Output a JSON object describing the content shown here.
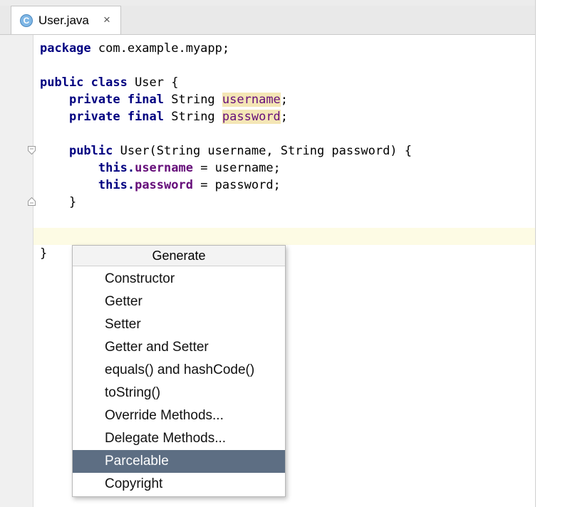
{
  "tab": {
    "icon_letter": "C",
    "label": "User.java",
    "close": "×"
  },
  "code": {
    "l1_kw": "package",
    "l1_rest": " com.example.myapp;",
    "l3_kw": "public class",
    "l3_rest": " User {",
    "l4_kw": "private final",
    "l4_type": " String ",
    "l4_field": "username",
    "l5_kw": "private final",
    "l5_type": " String ",
    "l5_field": "password",
    "l7_kw": "public",
    "l7_rest": " User(String username, String password) {",
    "l8_kw": "this.",
    "l8_field": "username",
    "l8_rest": " = username;",
    "l9_kw": "this.",
    "l9_field": "password",
    "l9_rest": " = password;",
    "l10": "}",
    "l13": "}"
  },
  "popup": {
    "title": "Generate",
    "items": [
      "Constructor",
      "Getter",
      "Setter",
      "Getter and Setter",
      "equals() and hashCode()",
      "toString()",
      "Override Methods...",
      "Delegate Methods...",
      "Parcelable",
      "Copyright"
    ],
    "selected": "Parcelable"
  },
  "colors": {
    "keyword": "#000080",
    "field": "#660e7a",
    "selection": "#5d6e83",
    "caret_line": "#fdfbe4",
    "usage_highlight": "#f4e6b5"
  },
  "icons": {
    "tab": "class-icon",
    "fold_start": "fold-start-icon",
    "fold_end": "fold-end-icon"
  }
}
